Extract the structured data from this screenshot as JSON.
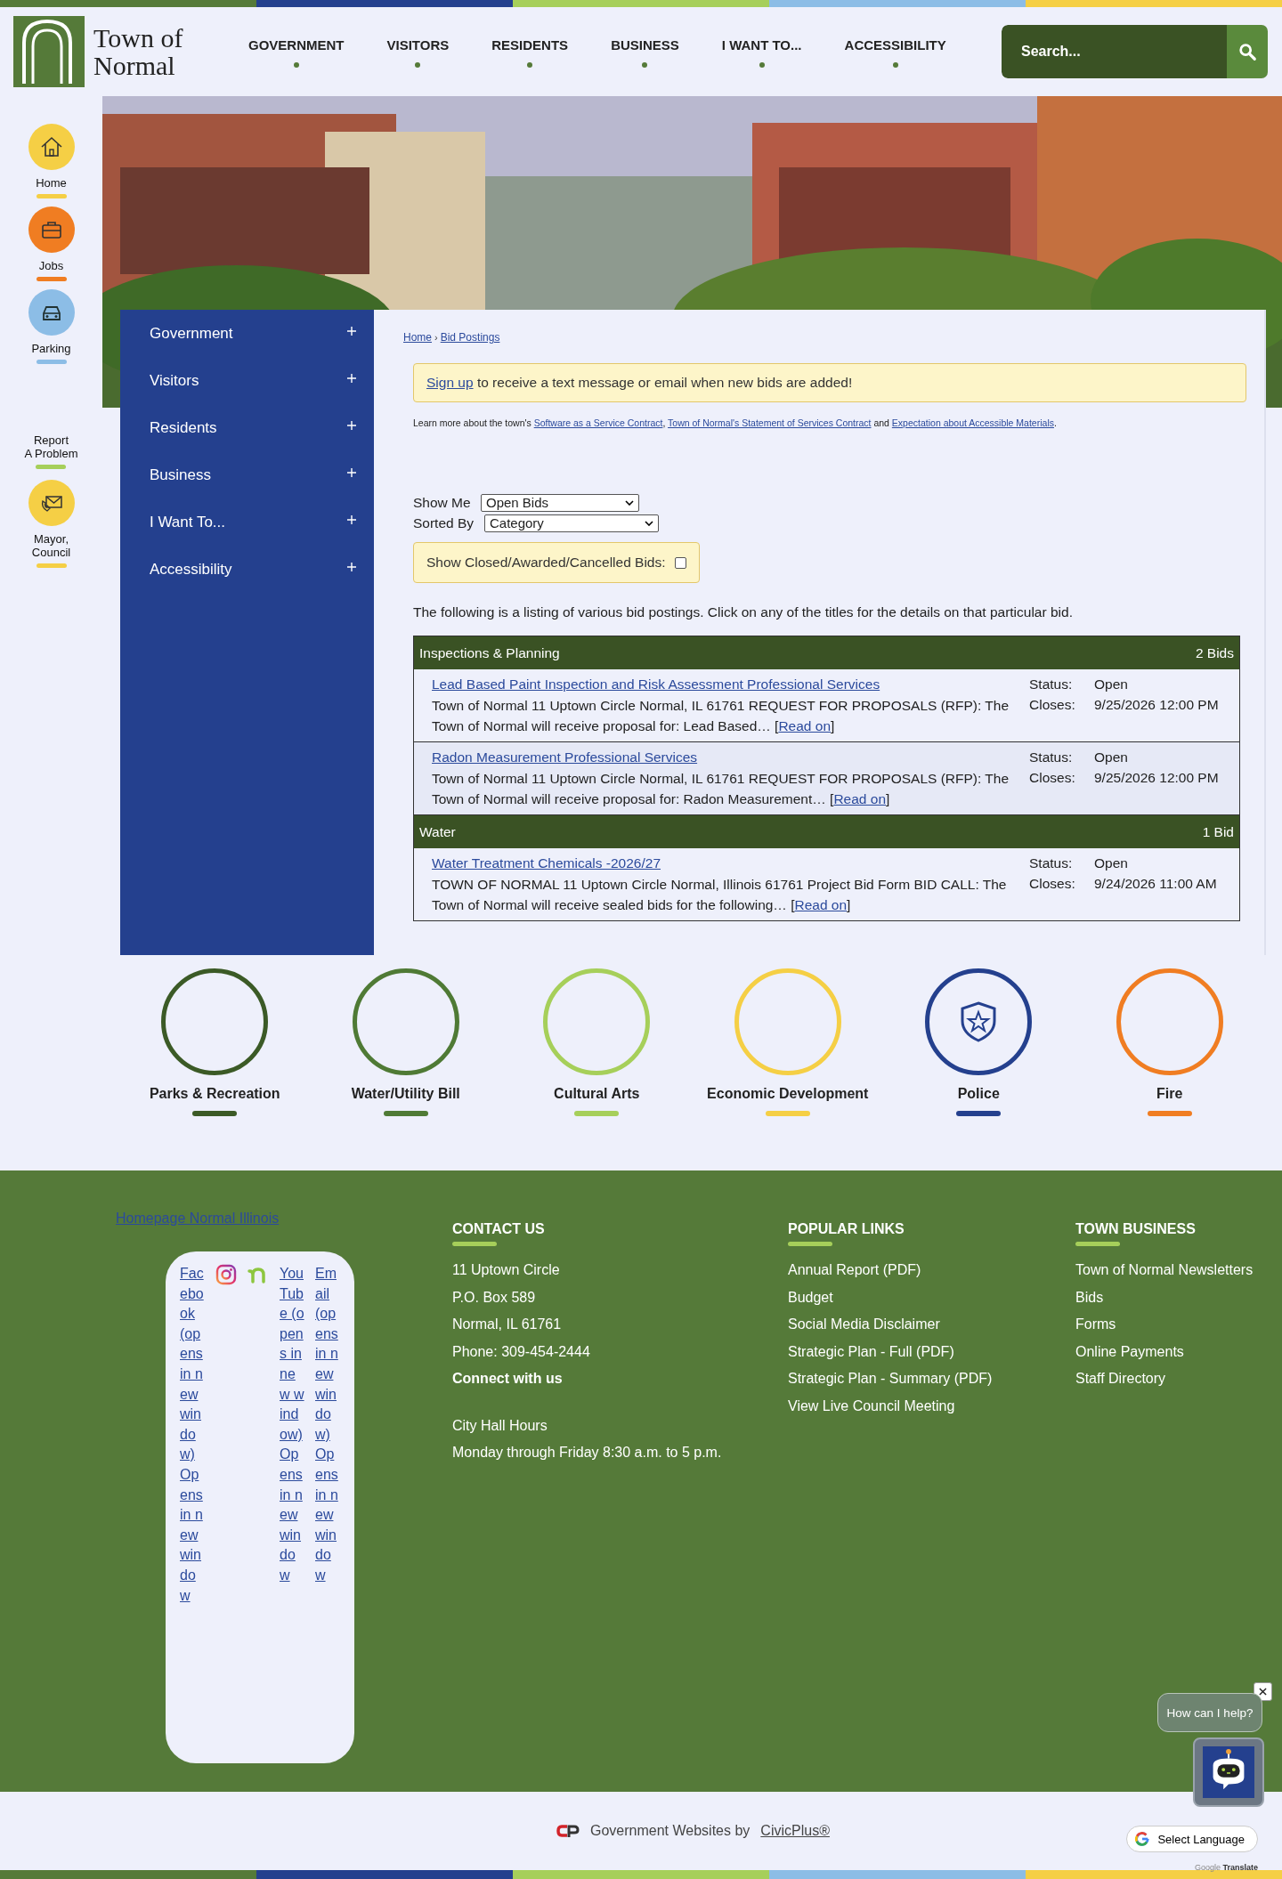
{
  "header": {
    "logo": {
      "line_1": "Town of",
      "line_2": "Normal"
    },
    "nav": [
      "GOVERNMENT",
      "VISITORS",
      "RESIDENTS",
      "BUSINESS",
      "I WANT TO...",
      "ACCESSIBILITY"
    ],
    "search": {
      "placeholder": "Search..."
    }
  },
  "quick_links": [
    {
      "kind": "home",
      "lines": [
        "Home"
      ],
      "color": "#f5cf45"
    },
    {
      "kind": "briefcase",
      "lines": [
        "Jobs"
      ],
      "color": "#f07d22"
    },
    {
      "kind": "car",
      "lines": [
        "Parking"
      ],
      "color": "#8cbde6"
    },
    {
      "kind": "text",
      "lines": [
        "Report",
        "A Problem"
      ],
      "color": "#a6cf5a"
    },
    {
      "kind": "mail",
      "lines": [
        "Mayor,",
        "Council"
      ],
      "color": "#f5cf45"
    }
  ],
  "side_nav": [
    "Government",
    "Visitors",
    "Residents",
    "Business",
    "I Want To...",
    "Accessibility"
  ],
  "breadcrumb": {
    "items": [
      "Home",
      "Bid Postings"
    ],
    "separator": "›"
  },
  "signup_notice": {
    "link": "Sign up",
    "text": "to receive a text message or email when new bids are added!"
  },
  "learn_more": [
    {
      "kind": "text",
      "text": "Learn more about the town's "
    },
    {
      "kind": "link",
      "text": "Software as a Service Contract"
    },
    {
      "kind": "text",
      "text": ",  "
    },
    {
      "kind": "link",
      "text": "Town of Normal's Statement of Services Contract"
    },
    {
      "kind": "text",
      "text": " and "
    },
    {
      "kind": "link",
      "text": "Expectation about Accessible Materials"
    },
    {
      "kind": "text",
      "text": "."
    }
  ],
  "filters": [
    {
      "label": "Show Me",
      "value": "Open Bids"
    },
    {
      "label": "Sorted By",
      "value": "Category"
    }
  ],
  "show_closed": {
    "label": "Show Closed/Awarded/Cancelled Bids:",
    "checked": false
  },
  "intro": "The following is a listing of various bid postings. Click on any of the titles for the details on that particular bid.",
  "categories": [
    {
      "name": "Inspections & Planning",
      "count": "2 Bids",
      "bids": [
        {
          "title": "Lead Based Paint Inspection and Risk Assessment Professional Services",
          "description": "Town of Normal 11 Uptown Circle Normal, IL 61761 REQUEST FOR PROPOSALS (RFP): The Town of Normal will receive proposal for: Lead Based… [",
          "read_more": "Read on",
          "after": "]",
          "status_label": "Status:",
          "status": "Open",
          "closes_label": "Closes:",
          "closes": "9/25/2026 12:00 PM"
        },
        {
          "title": "Radon Measurement Professional Services",
          "description": "Town of Normal 11 Uptown Circle Normal, IL 61761 REQUEST FOR PROPOSALS (RFP): The Town of Normal will receive proposal for: Radon Measurement… [",
          "read_more": "Read on",
          "after": "]",
          "status_label": "Status:",
          "status": "Open",
          "closes_label": "Closes:",
          "closes": "9/25/2026 12:00 PM"
        }
      ]
    },
    {
      "name": "Water",
      "count": "1 Bid",
      "bids": [
        {
          "title": "Water Treatment Chemicals -2026/27",
          "description": "TOWN OF NORMAL 11 Uptown Circle Normal, Illinois 61761 Project Bid Form BID CALL: The Town of Normal will receive sealed bids for the following… [",
          "read_more": "Read on",
          "after": "]",
          "status_label": "Status:",
          "status": "Open",
          "closes_label": "Closes:",
          "closes": "9/24/2026 11:00 AM"
        }
      ]
    }
  ],
  "services": [
    {
      "kind": "blank",
      "label": "Parks & Recreation",
      "color": "#3b5a26"
    },
    {
      "kind": "blank",
      "label": "Water/Utility Bill",
      "color": "#4f7a35"
    },
    {
      "kind": "blank",
      "label": "Cultural Arts",
      "color": "#a6cf5a"
    },
    {
      "kind": "blank",
      "label": "Economic Development",
      "color": "#f5cf45"
    },
    {
      "kind": "shield",
      "label": "Police",
      "color": "#24408e"
    },
    {
      "kind": "blank",
      "label": "Fire",
      "color": "#f07d22"
    }
  ],
  "footer": {
    "logo_alt": "Homepage Normal Illinois",
    "social": [
      {
        "kind": "broken",
        "text": "Facebook (opens in new window) Opens in new window"
      },
      {
        "kind": "instagram"
      },
      {
        "kind": "arch"
      },
      {
        "kind": "broken",
        "text": "YouTube (opens in new window) Opens in new window"
      },
      {
        "kind": "broken",
        "text": "Email (opens in new window) Opens in new window"
      }
    ],
    "contact": {
      "heading": "CONTACT US",
      "lines": [
        "11 Uptown Circle",
        "P.O. Box 589",
        "Normal, IL 61761",
        "Phone: 309-454-2444"
      ],
      "connect": "Connect with us",
      "hours_title": "City Hall Hours",
      "hours": "Monday through Friday 8:30 a.m. to 5 p.m."
    },
    "popular": {
      "heading": "POPULAR LINKS",
      "links": [
        "Annual Report (PDF)",
        "Budget",
        "Social Media Disclaimer",
        "Strategic Plan - Full (PDF)",
        "Strategic Plan - Summary (PDF)",
        "View Live Council Meeting"
      ]
    },
    "business": {
      "heading": "TOWN BUSINESS",
      "links": [
        "Town of Normal Newsletters",
        "Bids",
        "Forms",
        "Online Payments",
        "Staff Directory"
      ]
    }
  },
  "chat": {
    "prompt": "How can I help?"
  },
  "credit": {
    "text": "Government Websites by",
    "link": "CivicPlus®"
  },
  "translate": {
    "label": "Select Language",
    "brand": "Google",
    "suffix": "Translate"
  }
}
